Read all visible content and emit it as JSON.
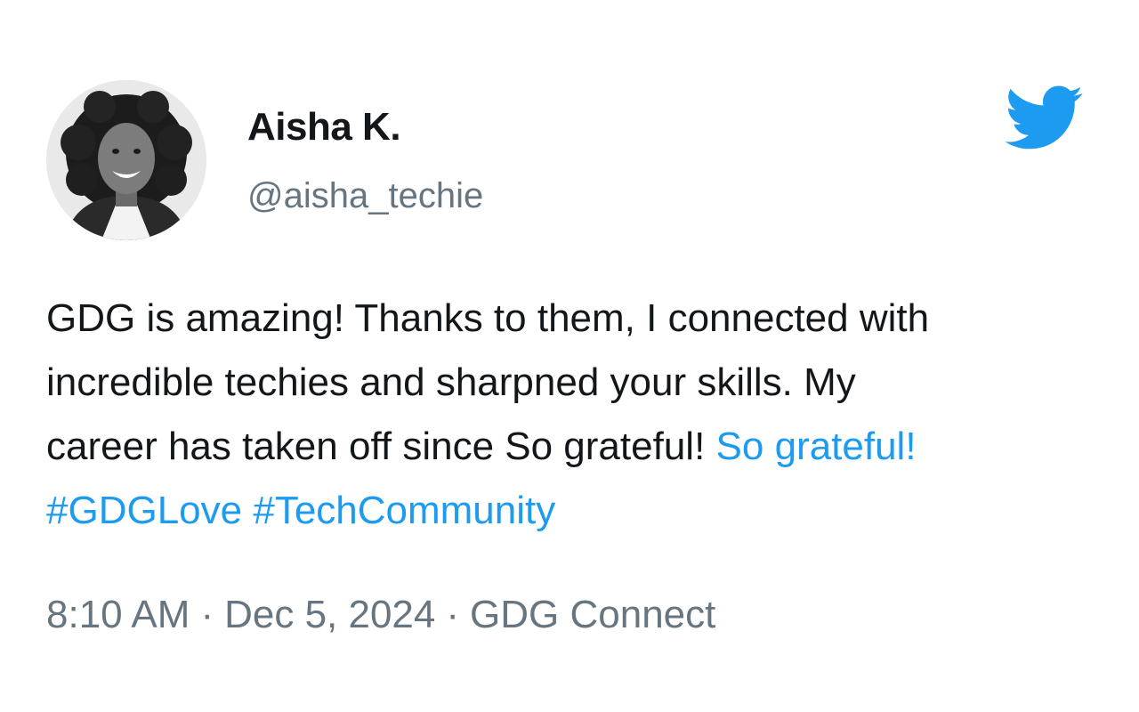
{
  "author": {
    "name": "Aisha K.",
    "handle": "@aisha_techie"
  },
  "icons": {
    "avatar": "profile-photo",
    "brand": "twitter-bird-icon"
  },
  "colors": {
    "link": "#1d9bf0",
    "text": "#14171a",
    "muted": "#66757f",
    "brand": "#1d9bf0"
  },
  "tweet": {
    "line1": "GDG is amazing! Thanks to them, I connected with",
    "line2": "incredible techies and sharpned your  skills. My",
    "line3_plain": "career has taken off since  So grateful!",
    "line3_link": "So grateful!",
    "hashtags": [
      "#GDGLove",
      "#TechCommunity"
    ]
  },
  "meta": {
    "time": "8:10 AM",
    "date": "Dec 5, 2024",
    "source": "GDG Connect",
    "separator": "·"
  }
}
